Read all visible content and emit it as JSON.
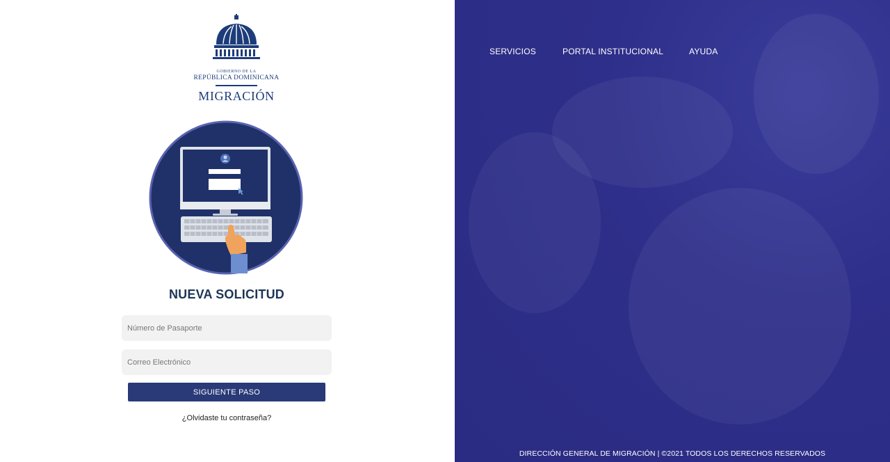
{
  "logo": {
    "gobierno": "GOBIERNO DE LA",
    "republica": "REPÚBLICA DOMINICANA",
    "migracion": "MIGRACIÓN"
  },
  "form": {
    "title": "NUEVA SOLICITUD",
    "passport_placeholder": "Número de Pasaporte",
    "passport_value": "",
    "email_placeholder": "Correo Electrónico",
    "email_value": "",
    "submit_label": "SIGUIENTE PASO",
    "forgot_label": "¿Olvidaste tu contraseña?"
  },
  "nav": {
    "items": [
      {
        "label": "SERVICIOS"
      },
      {
        "label": "PORTAL INSTITUCIONAL"
      },
      {
        "label": "AYUDA"
      }
    ]
  },
  "footer": {
    "text": "DIRECCIÓN GENERAL DE MIGRACIÓN | ©2021 TODOS LOS DERECHOS RESERVADOS"
  },
  "colors": {
    "brand_navy": "#1d3c7a",
    "button": "#2a3a78",
    "panel": "#2e2f8a"
  }
}
